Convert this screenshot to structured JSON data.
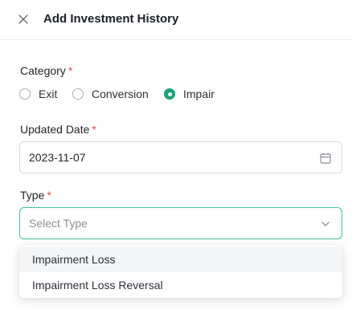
{
  "header": {
    "title": "Add Investment History",
    "close_icon": "close-icon"
  },
  "colors": {
    "accent": "#1aa37a",
    "required": "#e5484d",
    "focus_border": "#3ec491"
  },
  "category": {
    "label": "Category",
    "required_mark": "*",
    "options": [
      "Exit",
      "Conversion",
      "Impair"
    ],
    "selected": "Impair"
  },
  "updated_date": {
    "label": "Updated Date",
    "required_mark": "*",
    "value": "2023-11-07",
    "icon": "calendar-icon"
  },
  "type": {
    "label": "Type",
    "required_mark": "*",
    "placeholder": "Select Type",
    "icon": "chevron-down-icon",
    "options": [
      "Impairment Loss",
      "Impairment Loss Reversal"
    ]
  }
}
